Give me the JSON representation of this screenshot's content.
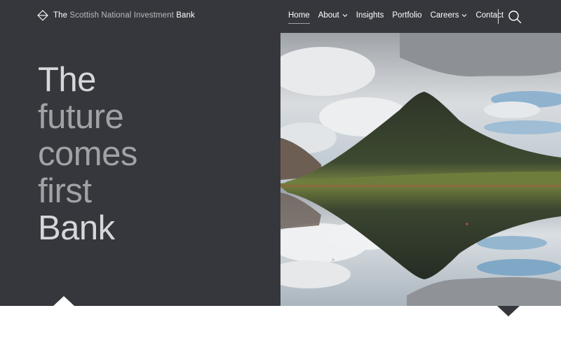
{
  "brand": {
    "prefix": "The",
    "middle": "Scottish National Investment",
    "suffix": "Bank"
  },
  "nav": {
    "items": [
      {
        "label": "Home",
        "active": true,
        "has_dropdown": false
      },
      {
        "label": "About",
        "active": false,
        "has_dropdown": true
      },
      {
        "label": "Insights",
        "active": false,
        "has_dropdown": false
      },
      {
        "label": "Portfolio",
        "active": false,
        "has_dropdown": false
      },
      {
        "label": "Careers",
        "active": false,
        "has_dropdown": true
      },
      {
        "label": "Contact",
        "active": false,
        "has_dropdown": false
      }
    ]
  },
  "search": {
    "icon": "search-icon"
  },
  "hero": {
    "lines": [
      "The",
      "future",
      "comes",
      "first",
      "Bank"
    ],
    "image_subject": "mountain-reflected-in-lake"
  },
  "colors": {
    "dark": "#36373d",
    "title_muted": "#a0a2a6",
    "title_bright": "#d6d7d9",
    "white": "#ffffff"
  }
}
